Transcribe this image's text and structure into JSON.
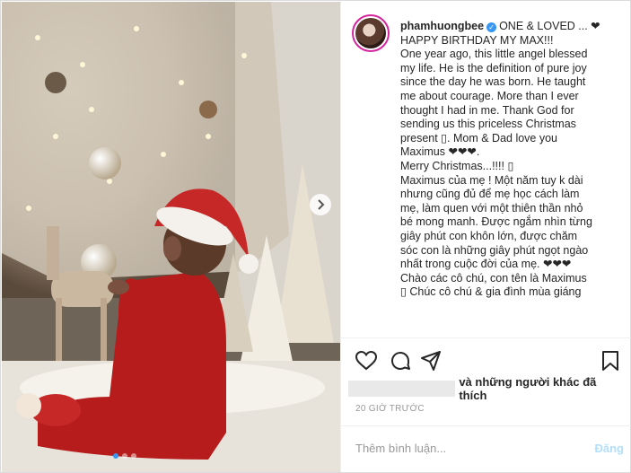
{
  "post": {
    "username": "phamhuongbee",
    "caption_lines": [
      "ONE & LOVED ... ❤",
      "HAPPY BIRTHDAY MY MAX!!!",
      "One year ago, this little angel blessed",
      "my life. He is the definition of pure joy",
      "since the day he was born. He taught",
      "me about courage. More than I ever",
      "thought I had in me. Thank God for",
      "sending us this priceless Christmas",
      "present ▯. Mom & Dad love you",
      "Maximus ❤❤❤.",
      "Merry Christmas...!!!! ▯",
      "Maximus của mẹ ! Một năm tuy k dài",
      "nhưng cũng đủ để mẹ học cách làm",
      "mẹ, làm quen với một thiên thần nhỏ",
      "bé mong manh. Được ngắm nhìn từng",
      "giây phút con khôn lớn, được chăm",
      "sóc con là những giây phút ngọt ngào",
      "nhất trong cuộc đời của mẹ. ❤❤❤",
      "Chào các cô chú, con tên là Maximus",
      "▯ Chúc cô chú & gia đình mùa giáng"
    ],
    "likes_text": "và những người khác đã thích",
    "timestamp": "20 GIỜ TRƯỚC",
    "comment_placeholder": "Thêm bình luận...",
    "post_button": "Đăng"
  },
  "icons": {
    "like": "heart-icon",
    "comment": "comment-icon",
    "share": "share-icon",
    "save": "bookmark-icon",
    "next": "chevron-right-icon",
    "verified": "verified-badge-icon"
  },
  "carousel": {
    "slides": 3,
    "active_index": 0
  },
  "colors": {
    "accent": "#3897f0",
    "post_button_disabled": "#b2dffc",
    "muted": "#999999"
  }
}
